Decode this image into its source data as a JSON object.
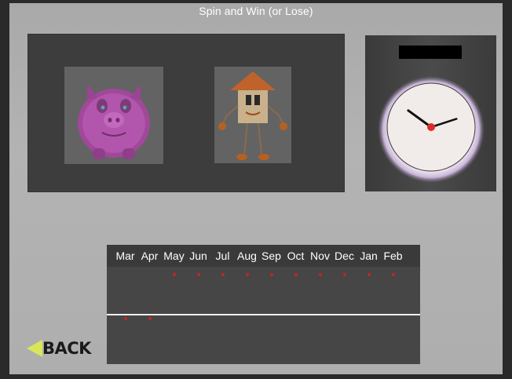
{
  "title": "Spin and Win (or Lose)",
  "cards": [
    {
      "name": "piggy-bank",
      "icon": "piggy-bank-icon"
    },
    {
      "name": "house-character",
      "icon": "house-character-icon"
    }
  ],
  "clock": {
    "display_text": "",
    "hour": 10,
    "minute": 12
  },
  "timeline": {
    "months": [
      "Mar",
      "Apr",
      "May",
      "Jun",
      "Jul",
      "Aug",
      "Sep",
      "Oct",
      "Nov",
      "Dec",
      "Jan",
      "Feb"
    ],
    "markers": [
      {
        "month": "Mar",
        "band": "below-line"
      },
      {
        "month": "Apr",
        "band": "below-line"
      },
      {
        "month": "May",
        "band": "above-line"
      },
      {
        "month": "Jun",
        "band": "above-line"
      },
      {
        "month": "Jul",
        "band": "above-line"
      },
      {
        "month": "Aug",
        "band": "above-line"
      },
      {
        "month": "Sep",
        "band": "above-line"
      },
      {
        "month": "Oct",
        "band": "above-line"
      },
      {
        "month": "Nov",
        "band": "above-line"
      },
      {
        "month": "Dec",
        "band": "above-line"
      },
      {
        "month": "Jan",
        "band": "above-line"
      },
      {
        "month": "Feb",
        "band": "above-line"
      }
    ],
    "marker_color": "#cc2222"
  },
  "back_button": {
    "label": "BACK",
    "arrow_color": "#d9e65a"
  }
}
